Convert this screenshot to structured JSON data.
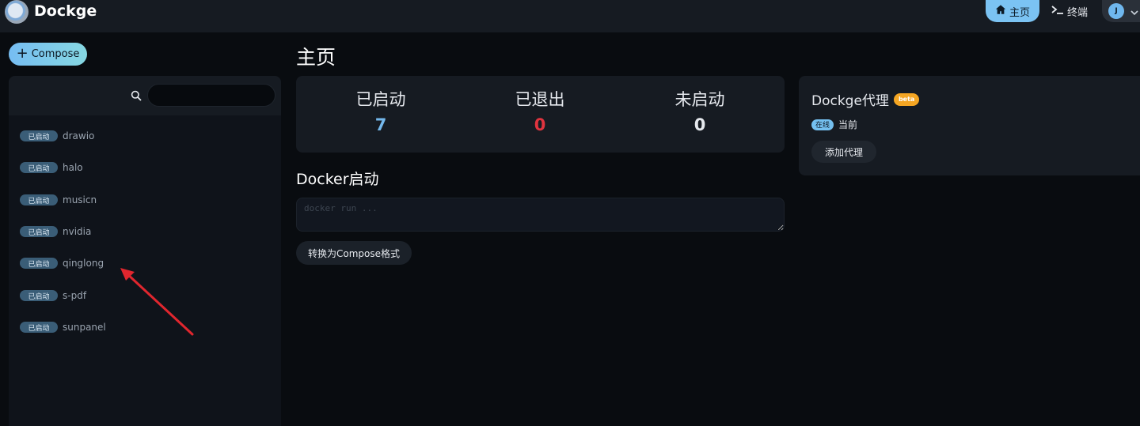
{
  "header": {
    "brand": "Dockge",
    "home_label": "主页",
    "terminal_label": "终端",
    "avatar_initial": "J"
  },
  "sidebar": {
    "compose_label": "Compose",
    "search_value": "",
    "stacks": [
      {
        "status": "已启动",
        "name": "drawio"
      },
      {
        "status": "已启动",
        "name": "halo"
      },
      {
        "status": "已启动",
        "name": "musicn"
      },
      {
        "status": "已启动",
        "name": "nvidia"
      },
      {
        "status": "已启动",
        "name": "qinglong"
      },
      {
        "status": "已启动",
        "name": "s-pdf"
      },
      {
        "status": "已启动",
        "name": "sunpanel"
      }
    ]
  },
  "main": {
    "title": "主页",
    "stats": [
      {
        "label": "已启动",
        "value": "7",
        "color": "#74b8ec"
      },
      {
        "label": "已退出",
        "value": "0",
        "color": "#e0343f"
      },
      {
        "label": "未启动",
        "value": "0",
        "color": "#e6e9ee"
      }
    ],
    "docker_run_title": "Docker启动",
    "docker_run_placeholder": "docker run ...",
    "convert_label": "转换为Compose格式"
  },
  "agent": {
    "title": "Dockge代理",
    "beta_label": "beta",
    "online_label": "在线",
    "current_label": "当前",
    "add_label": "添加代理"
  },
  "colors": {
    "accent": "#7bc3f3",
    "background": "#090c10",
    "card": "#161b22",
    "annotation_arrow": "#e0262e"
  }
}
